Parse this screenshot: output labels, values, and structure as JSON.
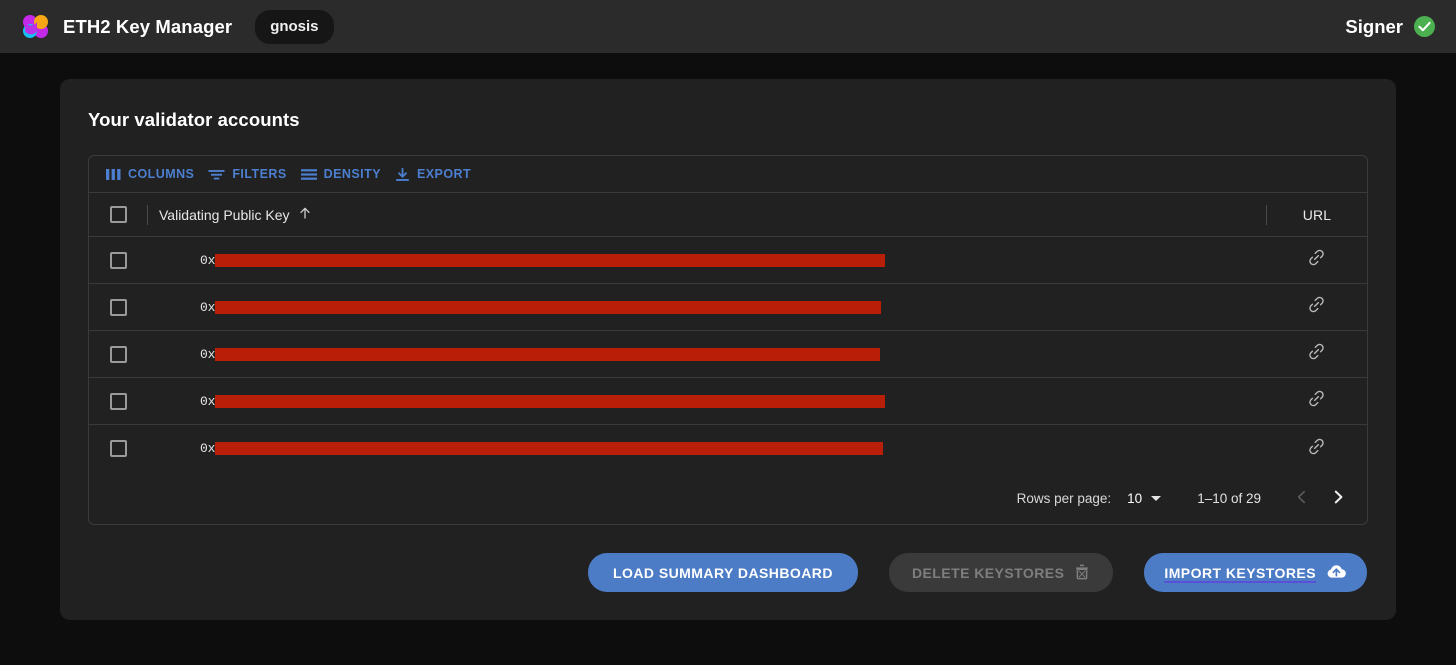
{
  "header": {
    "logo_icon": "eth2-keymanager-logo-icon",
    "app_title": "ETH2 Key Manager",
    "network_chip": "gnosis",
    "signer_label": "Signer",
    "signer_status_icon": "check-circle-icon",
    "signer_status_color": "#4caf50"
  },
  "card": {
    "title": "Your validator accounts"
  },
  "toolbar": {
    "items": [
      {
        "label": "COLUMNS",
        "icon": "columns-icon"
      },
      {
        "label": "FILTERS",
        "icon": "filter-icon"
      },
      {
        "label": "DENSITY",
        "icon": "density-icon"
      },
      {
        "label": "EXPORT",
        "icon": "export-icon"
      }
    ],
    "accent_color": "#4c7fd0"
  },
  "table": {
    "columns": [
      {
        "label": "Validating Public Key",
        "sort": "asc",
        "sort_icon": "arrow-up-icon"
      },
      {
        "label": "URL"
      }
    ],
    "select_all_checked": false,
    "redaction_color": "#b81e08",
    "rows": [
      {
        "key_prefix": "0x",
        "key_redacted_width": 670,
        "url_icon": "link-icon",
        "checked": false
      },
      {
        "key_prefix": "0x",
        "key_redacted_width": 666,
        "url_icon": "link-icon",
        "checked": false
      },
      {
        "key_prefix": "0x",
        "key_redacted_width": 665,
        "url_icon": "link-icon",
        "checked": false
      },
      {
        "key_prefix": "0x",
        "key_redacted_width": 670,
        "url_icon": "link-icon",
        "checked": false
      },
      {
        "key_prefix": "0x",
        "key_redacted_width": 668,
        "url_icon": "link-icon",
        "checked": false
      }
    ]
  },
  "pagination": {
    "rows_per_page_label": "Rows per page:",
    "rows_per_page_value": "10",
    "range_label": "1–10 of 29",
    "prev_icon": "chevron-left-icon",
    "next_icon": "chevron-right-icon",
    "prev_enabled": false,
    "next_enabled": true
  },
  "actions": {
    "load_summary_label": "LOAD SUMMARY DASHBOARD",
    "delete_keystores_label": "DELETE KEYSTORES",
    "delete_keystores_icon": "trash-icon",
    "delete_keystores_enabled": false,
    "import_keystores_label": "IMPORT KEYSTORES",
    "import_keystores_icon": "cloud-upload-icon",
    "primary_color": "#4d7cc7",
    "underline_color": "#5b4fd8"
  }
}
